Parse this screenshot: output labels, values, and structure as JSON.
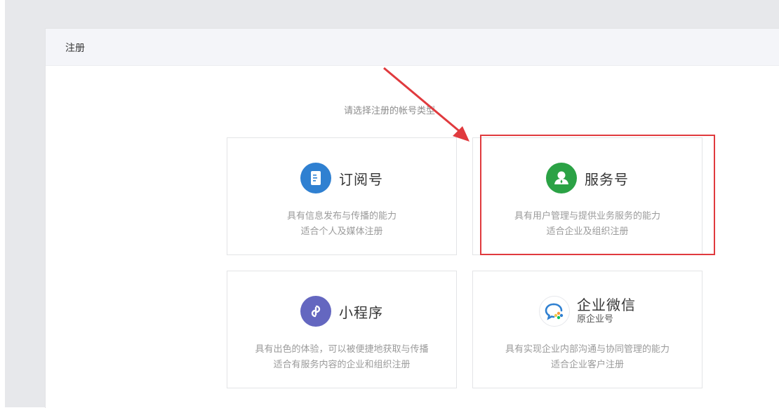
{
  "panel": {
    "title": "注册"
  },
  "prompt": "请选择注册的帐号类型",
  "cards": [
    {
      "title": "订阅号",
      "subtitle": "",
      "desc_line1": "具有信息发布与传播的能力",
      "desc_line2": "适合个人及媒体注册",
      "icon": "document-icon",
      "color": "#2f80d1"
    },
    {
      "title": "服务号",
      "subtitle": "",
      "desc_line1": "具有用户管理与提供业务服务的能力",
      "desc_line2": "适合企业及组织注册",
      "icon": "person-icon",
      "color": "#2ba245"
    },
    {
      "title": "小程序",
      "subtitle": "",
      "desc_line1": "具有出色的体验，可以被便捷地获取与传播",
      "desc_line2": "适合有服务内容的企业和组织注册",
      "icon": "link-icon",
      "color": "#6467c0"
    },
    {
      "title": "企业微信",
      "subtitle": "原企业号",
      "desc_line1": "具有实现企业内部沟通与协同管理的能力",
      "desc_line2": "适合企业客户注册",
      "icon": "chat-bubble-icon",
      "color": "#2f80d1"
    }
  ],
  "annotation": {
    "highlight_color": "#e03a3e"
  }
}
